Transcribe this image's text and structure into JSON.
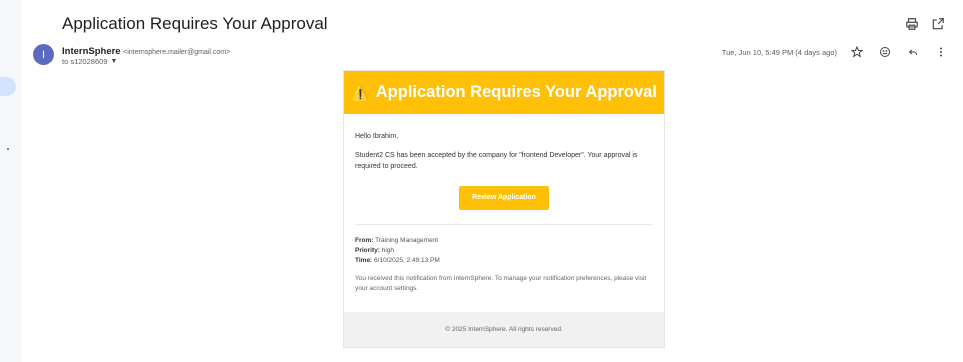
{
  "email": {
    "subject": "Application Requires Your Approval",
    "avatar_letter": "I",
    "sender_name": "InternSphere",
    "sender_email": "<internsphere.mailer@gmail.com>",
    "to": "to s12028609",
    "date": "Tue, Jun 10, 5:49 PM (4 days ago)"
  },
  "icons": {
    "print": "print-icon",
    "popout": "open-in-new-icon",
    "star": "star-icon",
    "emoji": "emoji-icon",
    "reply": "reply-icon",
    "more": "more-vert-icon",
    "warning": "warning-icon"
  },
  "card": {
    "warning_glyph": "⚠️",
    "title": "Application Requires Your Approval",
    "greeting": "Hello Ibrahim,",
    "message": "Student2 CS has been accepted by the company for \"frontend Developer\". Your approval is required to proceed.",
    "button_label": "Review Application",
    "from_label": "From:",
    "from_value": "Training Management",
    "priority_label": "Priority:",
    "priority_value": "high",
    "time_label": "Time:",
    "time_value": "6/10/2025, 2:49:13 PM",
    "notice": "You received this notification from InternSphere. To manage your notification preferences, please visit your account settings.",
    "footer": "© 2025 InternSphere. All rights reserved."
  },
  "colors": {
    "accent": "#ffc107",
    "avatar": "#5c6bc0"
  }
}
